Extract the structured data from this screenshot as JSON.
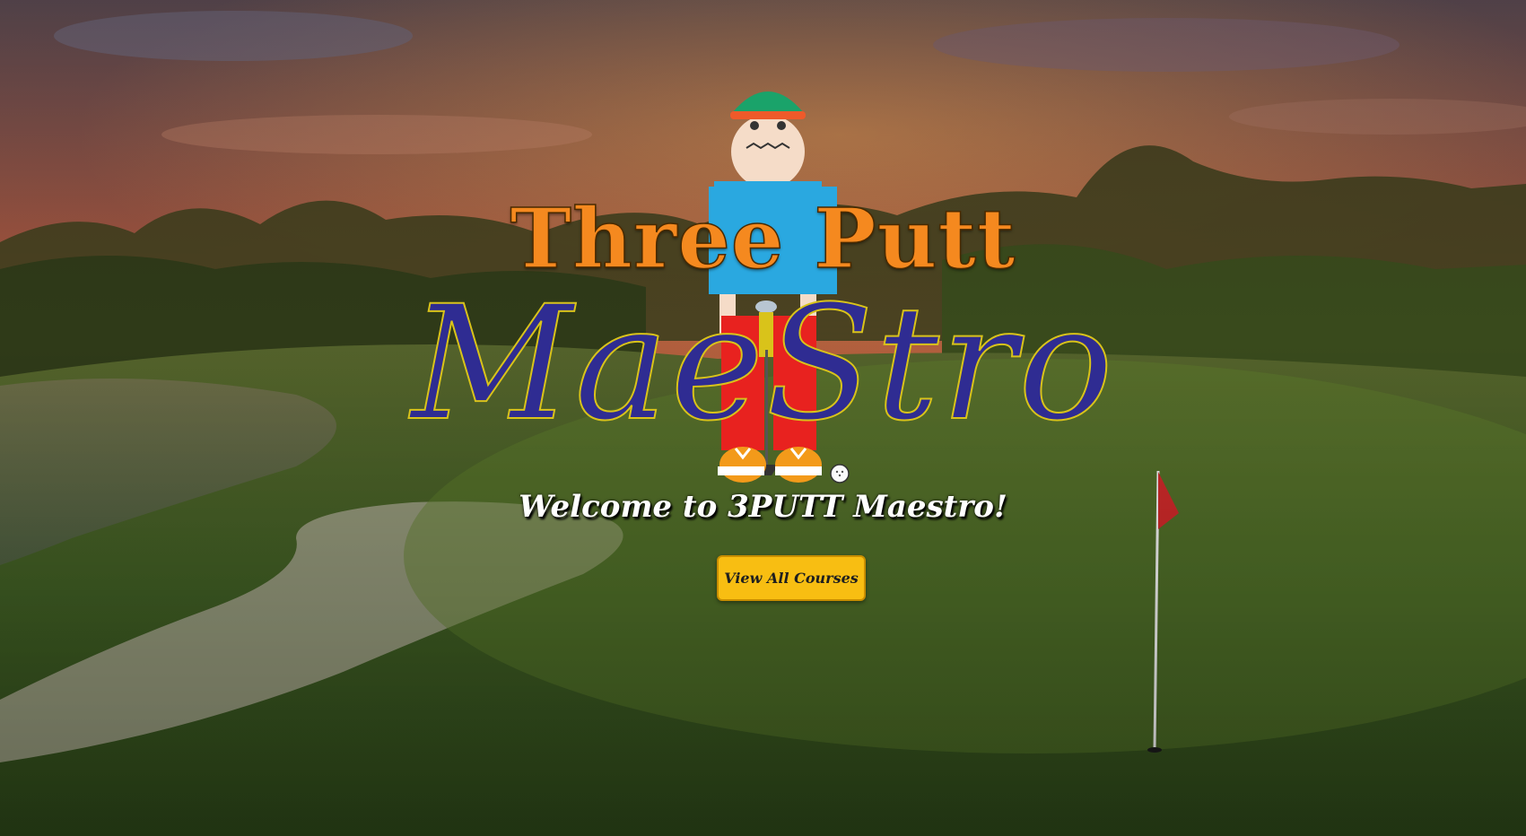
{
  "hero": {
    "title_top": "Three Putt",
    "title_script": "MaeStro",
    "welcome": "Welcome to 3PUTT Maestro!",
    "cta_label": "View All Courses"
  },
  "colors": {
    "title_top": "#f5891f",
    "title_script": "#2f2c92",
    "title_script_outline": "#d9c31a",
    "cta_background": "#f8be12",
    "cap": "#1aa36a",
    "shirt": "#2aa8e0",
    "pants": "#e8221f",
    "shoes": "#f39a1a",
    "flag": "#c62828"
  },
  "icons": [
    "golf-course-background",
    "golfer-mascot",
    "golf-ball-icon",
    "pin-flag-icon"
  ]
}
